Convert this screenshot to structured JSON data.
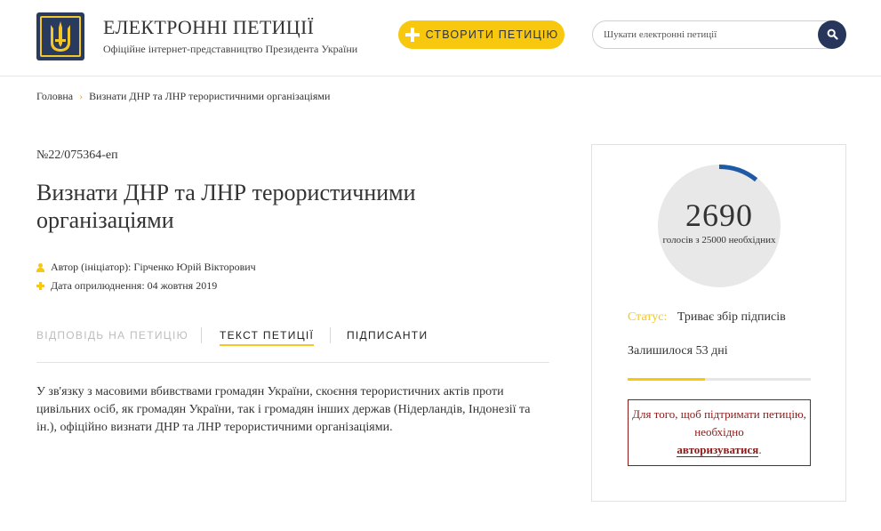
{
  "header": {
    "title": "ЕЛЕКТРОННІ ПЕТИЦІЇ",
    "subtitle": "Офіційне інтернет-представництво Президента України",
    "create_label": "СТВОРИТИ ПЕТИЦІЮ",
    "search_placeholder": "Шукати електронні петиції"
  },
  "breadcrumb": {
    "home": "Головна",
    "separator": "›",
    "current": "Визнати ДНР та ЛНР терористичними організаціями"
  },
  "petition": {
    "number": "№22/075364-еп",
    "title": "Визнати ДНР та ЛНР терористичними організаціями",
    "author_label": "Автор (ініціатор):",
    "author": "Гірченко Юрій Вікторович",
    "date_label": "Дата оприлюднення:",
    "date": "04 жовтня 2019",
    "body": "У зв'язку з масовими вбивствами громадян України, скоєння терористичних актів проти цивільних осіб, як громадян України, так і громадян інших держав (Нідерландів, Індонезії та ін.), офіційно визнати ДНР та ЛНР терористичними організаціями."
  },
  "tabs": [
    {
      "label": "ВІДПОВІДЬ НА ПЕТИЦІЮ",
      "state": "disabled"
    },
    {
      "label": "ТЕКСТ ПЕТИЦІЇ",
      "state": "active"
    },
    {
      "label": "ПІДПИСАНТИ",
      "state": "normal"
    }
  ],
  "sidebar": {
    "votes": 2690,
    "votes_text": "2690",
    "votes_caption": "голосів з 25000 необхідних",
    "votes_needed": 25000,
    "status_key": "Статус:",
    "status_value": "Триває збір підписів",
    "remaining": "Залишилося 53 дні",
    "time_progress": 0.42,
    "auth_text": "Для того, щоб підтримати петицію, необхідно",
    "auth_link": "авторизуватися",
    "auth_end": "."
  },
  "colors": {
    "accent_yellow": "#f8c80f",
    "navy": "#27365a",
    "progress_blue": "#1f5aa6",
    "circle_grey": "#e8e8e8",
    "auth_red": "#8b1a1a"
  },
  "icons": {
    "logo": "trident-emblem",
    "create": "plus-icon",
    "search": "search-icon",
    "author": "person-icon",
    "date": "plus-icon"
  }
}
